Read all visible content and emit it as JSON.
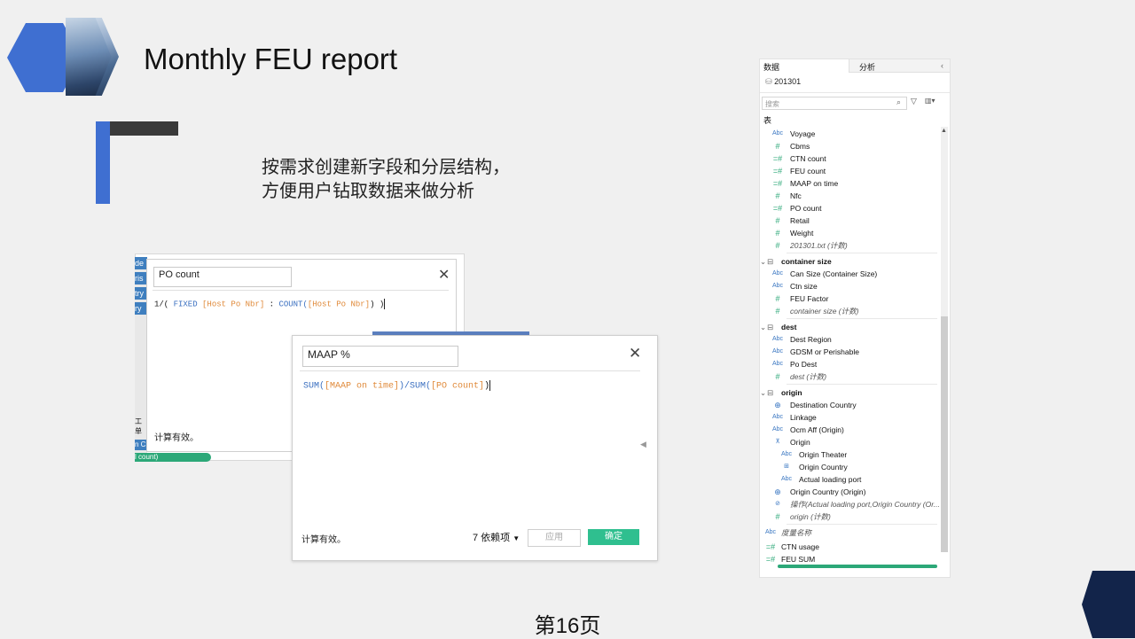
{
  "slide": {
    "title": "Monthly FEU report",
    "description_line1": "按需求创建新字段和分层结构，",
    "description_line2": "方便用户钻取数据来做分析",
    "page_label": "第16页"
  },
  "left_strip": {
    "tabs": [
      "de",
      "ris",
      "try",
      "ry"
    ],
    "labels": [
      "工单",
      "n C",
      "l count)"
    ]
  },
  "dialog_po": {
    "name": "PO count",
    "formula_prefix": "1/( ",
    "formula_fn1": "FIXED",
    "formula_field1": "[Host Po Nbr]",
    "formula_sep": " : ",
    "formula_fn2": "COUNT(",
    "formula_field2": "[Host Po Nbr]",
    "formula_suffix": ") )",
    "status": "计算有效。"
  },
  "dialog_maap": {
    "name": "MAAP %",
    "formula_fn1": "SUM(",
    "formula_field1": "[MAAP on time]",
    "formula_mid": ")/SUM(",
    "formula_field2": "[PO count]",
    "formula_suffix": ")",
    "status": "计算有效。",
    "dependencies": "7 依赖项",
    "apply_label": "应用",
    "ok_label": "确定"
  },
  "data_pane": {
    "tab_data": "数据",
    "tab_analysis": "分析",
    "source": "201301",
    "search_placeholder": "搜索",
    "tables_label": "表",
    "groups": [
      {
        "name": "",
        "items": [
          {
            "icon": "Abc",
            "label": "Voyage"
          },
          {
            "icon": "#",
            "label": "Cbms"
          },
          {
            "icon": "=#",
            "label": "CTN count"
          },
          {
            "icon": "=#",
            "label": "FEU count"
          },
          {
            "icon": "=#",
            "label": "MAAP on time"
          },
          {
            "icon": "#",
            "label": "Nfc"
          },
          {
            "icon": "=#",
            "label": "PO count"
          },
          {
            "icon": "#",
            "label": "Retail"
          },
          {
            "icon": "#",
            "label": "Weight"
          },
          {
            "icon": "#",
            "label": "201301.txt (计数)",
            "italic": true
          }
        ]
      },
      {
        "name": "container size",
        "items": [
          {
            "icon": "Abc",
            "label": "Can Size (Container Size)"
          },
          {
            "icon": "Abc",
            "label": "Ctn size"
          },
          {
            "icon": "#",
            "label": "FEU Factor"
          },
          {
            "icon": "#",
            "label": "container size (计数)",
            "italic": true
          }
        ]
      },
      {
        "name": "dest",
        "items": [
          {
            "icon": "Abc",
            "label": "Dest Region"
          },
          {
            "icon": "Abc",
            "label": "GDSM or Perishable"
          },
          {
            "icon": "Abc",
            "label": "Po Dest"
          },
          {
            "icon": "#",
            "label": "dest (计数)",
            "italic": true
          }
        ]
      },
      {
        "name": "origin",
        "items": [
          {
            "icon": "globe",
            "label": "Destination Country"
          },
          {
            "icon": "Abc",
            "label": "Linkage"
          },
          {
            "icon": "Abc",
            "label": "Ocm Aff (Origin)"
          },
          {
            "icon": "hier",
            "label": "Origin"
          },
          {
            "icon": "Abc",
            "label": "Origin Theater",
            "indent": true
          },
          {
            "icon": "map",
            "label": "Origin Country",
            "indent": true
          },
          {
            "icon": "Abc",
            "label": "Actual loading port",
            "indent": true
          },
          {
            "icon": "globe",
            "label": "Origin Country (Origin)"
          },
          {
            "icon": "link",
            "label": "操作(Actual loading port,Origin Country (Or...",
            "italic": true
          },
          {
            "icon": "#",
            "label": "origin (计数)",
            "italic": true
          }
        ]
      }
    ],
    "measure_names": "度量名称",
    "extra": [
      {
        "icon": "=#",
        "label": "CTN usage"
      },
      {
        "icon": "=#",
        "label": "FEU SUM"
      }
    ]
  }
}
